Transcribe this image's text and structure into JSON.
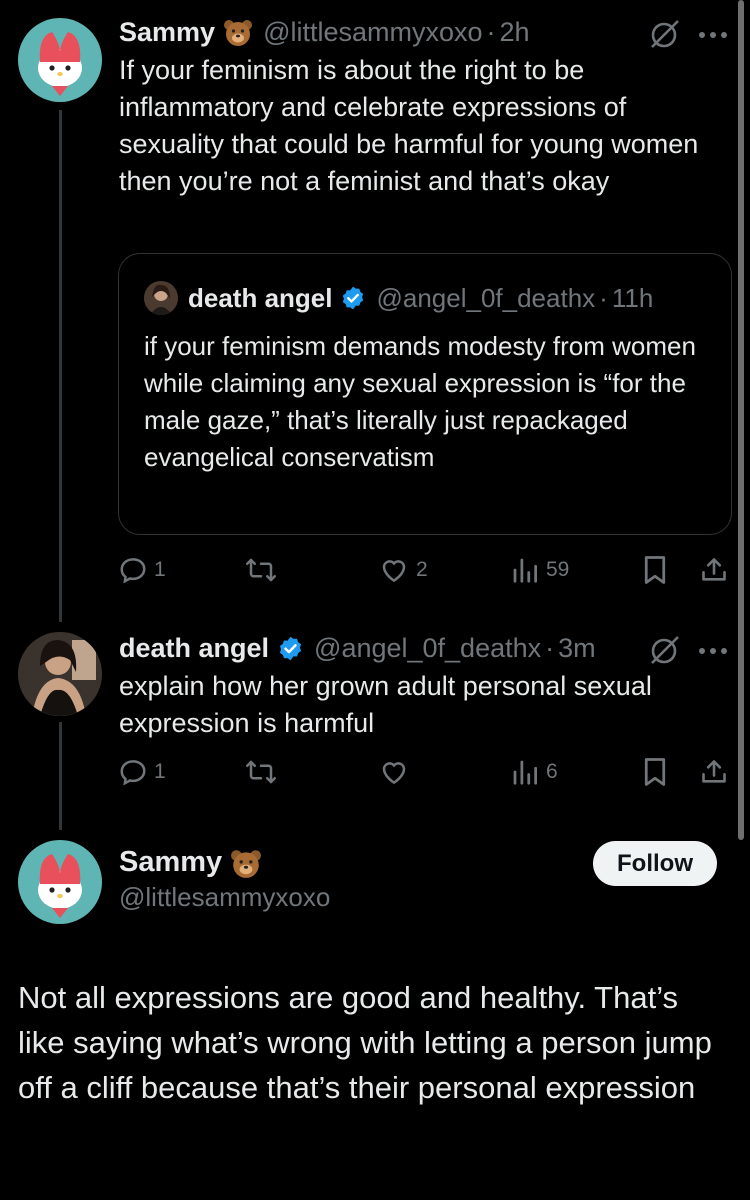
{
  "tweet1": {
    "name": "Sammy",
    "emoji": "bear-face",
    "handle": "@littlesammyxoxo",
    "sep": "·",
    "time": "2h",
    "text": "If your feminism is about the right to be inflammatory and celebrate expressions of sexuality that could be harmful for young women then you’re not a feminist and that’s okay",
    "quote": {
      "name": "death angel",
      "handle": "@angel_0f_deathx",
      "sep": "·",
      "time": "11h",
      "text": "if your feminism demands modesty from women while claiming any sexual expression is “for the male gaze,” that’s literally just repackaged evangelical conservatism"
    },
    "actions": {
      "replies": "1",
      "retweets": "",
      "likes": "2",
      "views": "59"
    }
  },
  "tweet2": {
    "name": "death angel",
    "handle": "@angel_0f_deathx",
    "sep": "·",
    "time": "3m",
    "text": "explain how her grown adult personal sexual expression is harmful",
    "actions": {
      "replies": "1",
      "retweets": "",
      "likes": "",
      "views": "6"
    }
  },
  "main_tweet": {
    "name": "Sammy",
    "emoji": "bear-face",
    "handle": "@littlesammyxoxo",
    "follow_label": "Follow",
    "text": "Not all expressions are good and healthy. That’s like saying what’s wrong with letting a person jump off a cliff because that’s their personal expression"
  },
  "colors": {
    "background": "#000000",
    "text": "#e7e9ea",
    "secondary": "#71767b",
    "verified": "#1d9bf0",
    "avatar_sammy": "#5fb5b3"
  }
}
